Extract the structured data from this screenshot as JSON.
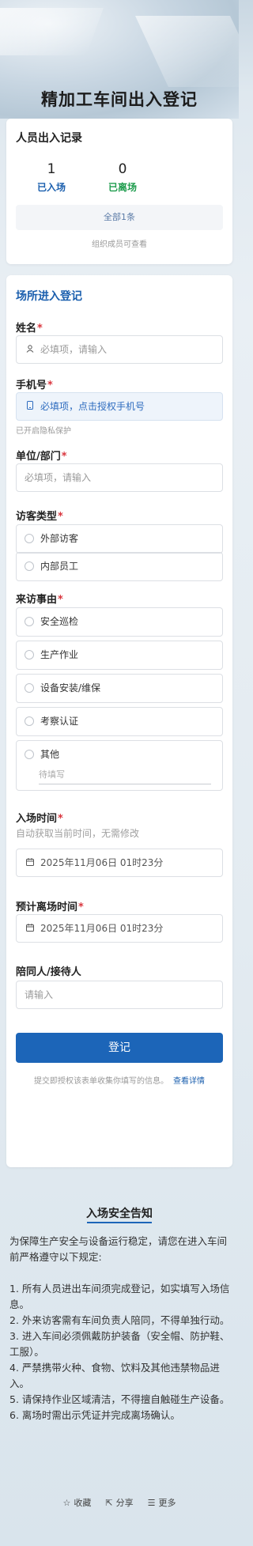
{
  "page": {
    "title": "精加工车间出入登记"
  },
  "records": {
    "title": "人员出入记录",
    "entered_count": "1",
    "entered_label": "已入场",
    "left_count": "0",
    "left_label": "已离场",
    "all_button": "全部1条",
    "note": "组织成员可查看"
  },
  "form": {
    "title": "场所进入登记",
    "name": {
      "label": "姓名",
      "placeholder": "必填项，请输入",
      "icon": "user-icon"
    },
    "phone": {
      "label": "手机号",
      "placeholder": "必填项，点击授权手机号",
      "hint": "已开启隐私保护",
      "icon": "phone-icon"
    },
    "unit": {
      "label": "单位/部门",
      "placeholder": "必填项，请输入"
    },
    "visitor_type": {
      "label": "访客类型",
      "options": [
        "外部访客",
        "内部员工"
      ]
    },
    "reason": {
      "label": "来访事由",
      "options": [
        "安全巡检",
        "生产作业",
        "设备安装/维保",
        "考察认证",
        "其他"
      ],
      "other_placeholder": "待填写"
    },
    "entry_time": {
      "label": "入场时间",
      "hint": "自动获取当前时间，无需修改",
      "value": "2025年11月06日 01时23分",
      "icon": "calendar-icon"
    },
    "exit_time": {
      "label": "预计离场时间",
      "value": "2025年11月06日 01时23分",
      "icon": "calendar-icon"
    },
    "companion": {
      "label": "陪同人/接待人",
      "placeholder": "请输入"
    },
    "submit_label": "登记",
    "privacy_text": "提交即授权该表单收集你填写的信息。",
    "privacy_link": "查看详情",
    "required_mark": "*"
  },
  "notice": {
    "title": "入场安全告知",
    "intro": "为保障生产安全与设备运行稳定，请您在进入车间前严格遵守以下规定:",
    "rules": [
      "1. 所有人员进出车间须完成登记，如实填写入场信息。",
      "2. 外来访客需有车间负责人陪同，不得单独行动。",
      "3. 进入车间必须佩戴防护装备（安全帽、防护鞋、工服）。",
      "4. 严禁携带火种、食物、饮料及其他违禁物品进入。",
      "5. 请保持作业区域清洁，不得擅自触碰生产设备。",
      "6. 离场时需出示凭证并完成离场确认。"
    ]
  },
  "footer": {
    "favorite": "收藏",
    "share": "分享",
    "more": "更多"
  },
  "colors": {
    "accent": "#1c65b8",
    "entered": "#1b5fae",
    "left": "#1e9c4d",
    "required": "#d9363e"
  }
}
